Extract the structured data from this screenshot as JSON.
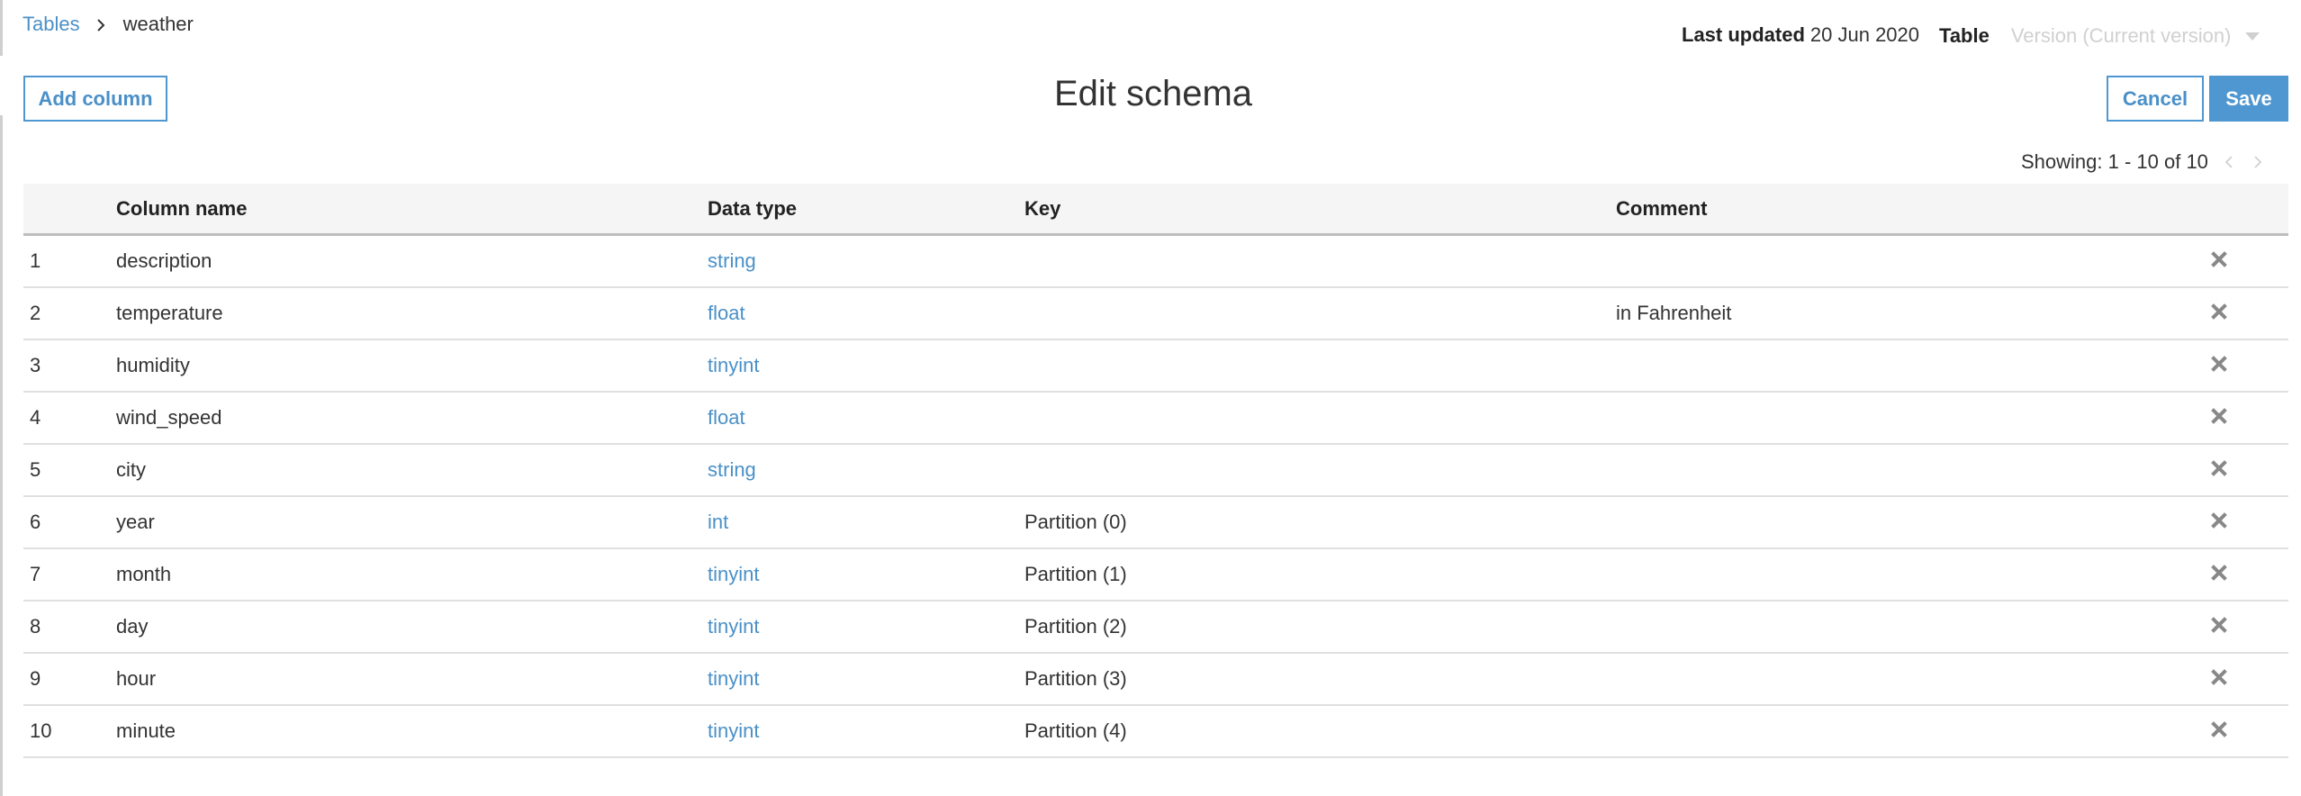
{
  "breadcrumb": {
    "parent": "Tables",
    "current": "weather"
  },
  "meta": {
    "last_updated_label": "Last updated",
    "last_updated_value": "20 Jun 2020",
    "table_label": "Table",
    "version_select": "Version (Current version)"
  },
  "page": {
    "title": "Edit schema"
  },
  "toolbar": {
    "add_column_label": "Add column",
    "cancel_label": "Cancel",
    "save_label": "Save"
  },
  "pagination": {
    "text": "Showing: 1 - 10 of 10",
    "prev_icon": "chevron-left-icon",
    "next_icon": "chevron-right-icon"
  },
  "table": {
    "headers": {
      "num": "",
      "name": "Column name",
      "type": "Data type",
      "key": "Key",
      "comment": "Comment"
    },
    "rows": [
      {
        "num": "1",
        "name": "description",
        "type": "string",
        "key": "",
        "comment": ""
      },
      {
        "num": "2",
        "name": "temperature",
        "type": "float",
        "key": "",
        "comment": "in Fahrenheit"
      },
      {
        "num": "3",
        "name": "humidity",
        "type": "tinyint",
        "key": "",
        "comment": ""
      },
      {
        "num": "4",
        "name": "wind_speed",
        "type": "float",
        "key": "",
        "comment": ""
      },
      {
        "num": "5",
        "name": "city",
        "type": "string",
        "key": "",
        "comment": ""
      },
      {
        "num": "6",
        "name": "year",
        "type": "int",
        "key": "Partition (0)",
        "comment": ""
      },
      {
        "num": "7",
        "name": "month",
        "type": "tinyint",
        "key": "Partition (1)",
        "comment": ""
      },
      {
        "num": "8",
        "name": "day",
        "type": "tinyint",
        "key": "Partition (2)",
        "comment": ""
      },
      {
        "num": "9",
        "name": "hour",
        "type": "tinyint",
        "key": "Partition (3)",
        "comment": ""
      },
      {
        "num": "10",
        "name": "minute",
        "type": "tinyint",
        "key": "Partition (4)",
        "comment": ""
      }
    ],
    "row_action_icon": "close-icon"
  },
  "colors": {
    "accent": "#4f97d1",
    "link": "#4a90c8",
    "text": "#333333",
    "muted": "#d0d0d0",
    "delete_icon": "#888888",
    "header_bg": "#f5f5f5"
  }
}
